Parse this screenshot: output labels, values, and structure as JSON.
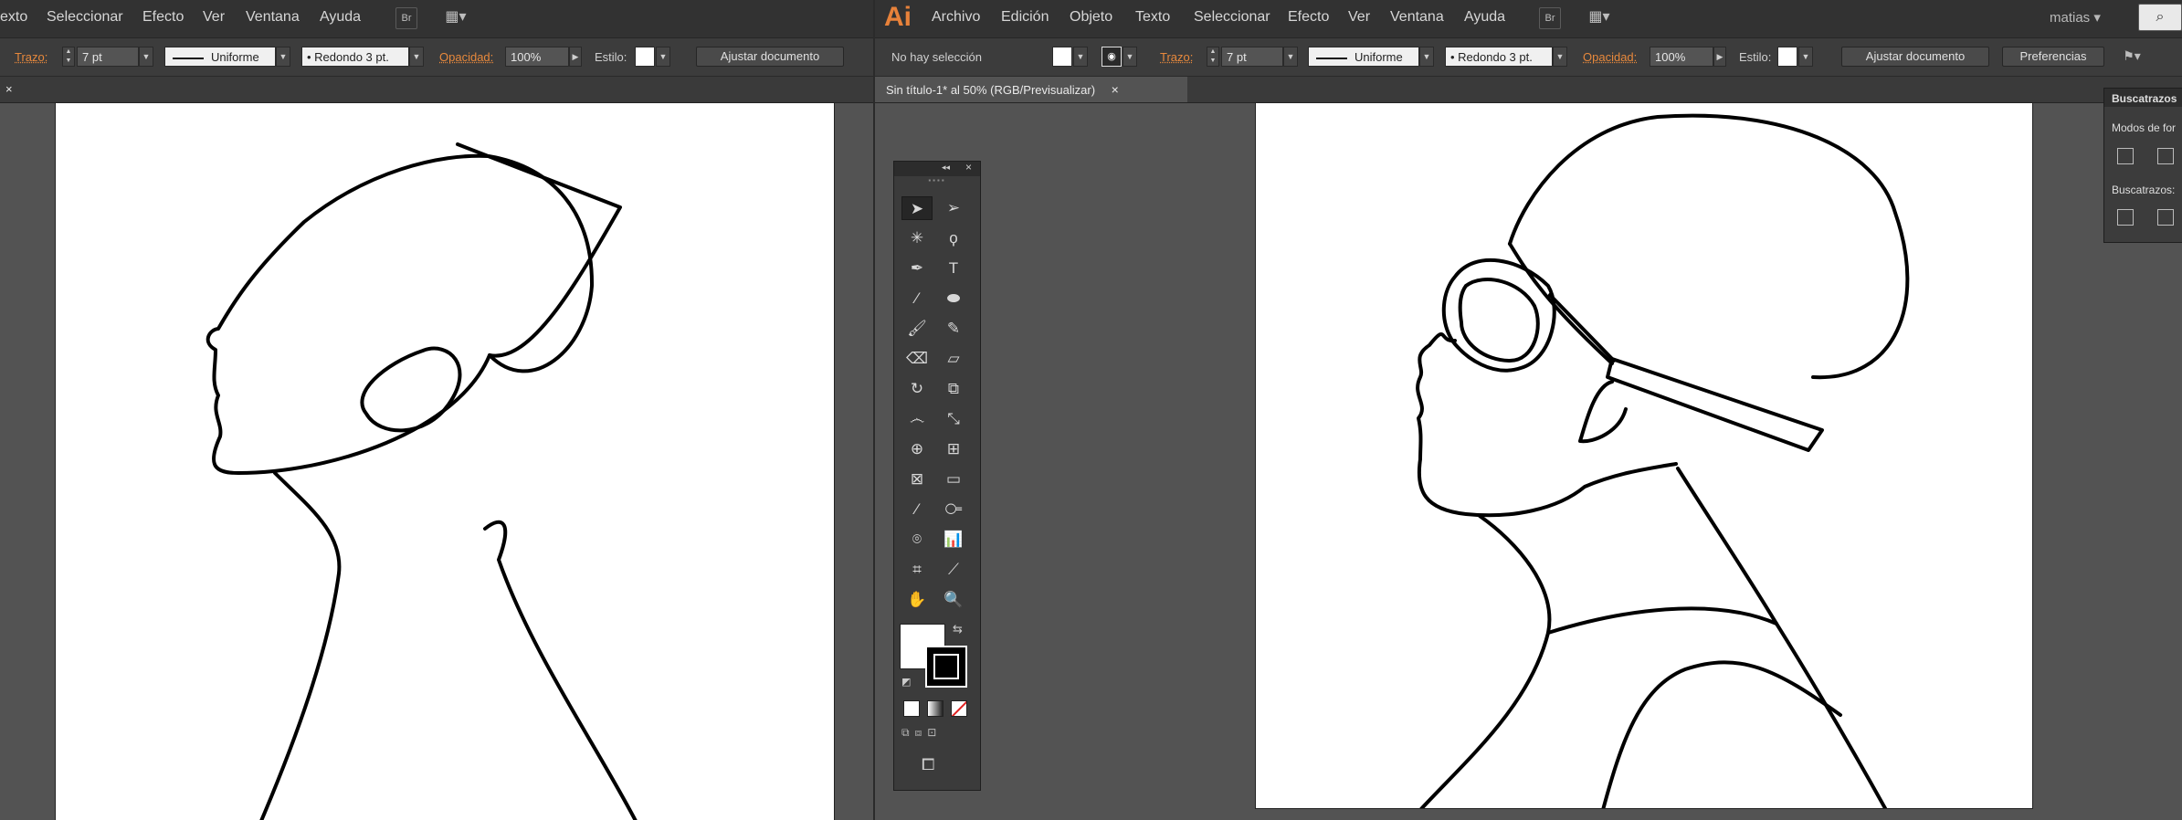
{
  "left_window": {
    "menu": [
      "exto",
      "Seleccionar",
      "Efecto",
      "Ver",
      "Ventana",
      "Ayuda"
    ],
    "bridge_icon": "Br",
    "control": {
      "stroke_label": "Trazo:",
      "stroke_value": "7 pt",
      "profile": "Uniforme",
      "brush": "Redondo 3 pt.",
      "opacity_label": "Opacidad:",
      "opacity_value": "100%",
      "style_label": "Estilo:",
      "fit_button": "Ajustar documento"
    },
    "tab_close": "×"
  },
  "right_window": {
    "app_logo": "Ai",
    "menu": [
      "Archivo",
      "Edición",
      "Objeto",
      "Texto",
      "Seleccionar",
      "Efecto",
      "Ver",
      "Ventana",
      "Ayuda"
    ],
    "bridge_icon": "Br",
    "user": "matias",
    "control": {
      "selection": "No hay selección",
      "stroke_label": "Trazo:",
      "stroke_value": "7 pt",
      "profile": "Uniforme",
      "brush": "Redondo 3 pt.",
      "opacity_label": "Opacidad:",
      "opacity_value": "100%",
      "style_label": "Estilo:",
      "fit_button": "Ajustar documento",
      "prefs_button": "Preferencias"
    },
    "document_tab": "Sin título-1* al 50% (RGB/Previsualizar)",
    "tab_close": "×",
    "pathfinder": {
      "title": "Buscatrazos",
      "modes_label": "Modos de for",
      "finders_label": "Buscatrazos:"
    }
  },
  "tools_panel": {
    "collapse": "◂◂",
    "close": "×",
    "tools": [
      {
        "name": "selection-tool",
        "glyph": "➤"
      },
      {
        "name": "direct-selection-tool",
        "glyph": "➢"
      },
      {
        "name": "magic-wand-tool",
        "glyph": "✳"
      },
      {
        "name": "lasso-tool",
        "glyph": "ϙ"
      },
      {
        "name": "pen-tool",
        "glyph": "✒"
      },
      {
        "name": "type-tool",
        "glyph": "T"
      },
      {
        "name": "line-tool",
        "glyph": "⁄"
      },
      {
        "name": "ellipse-tool",
        "glyph": "⬬"
      },
      {
        "name": "paintbrush-tool",
        "glyph": "🖌"
      },
      {
        "name": "pencil-tool",
        "glyph": "✎"
      },
      {
        "name": "blob-brush-tool",
        "glyph": "⌫"
      },
      {
        "name": "eraser-tool",
        "glyph": "▱"
      },
      {
        "name": "rotate-tool",
        "glyph": "↻"
      },
      {
        "name": "scale-tool",
        "glyph": "⧉"
      },
      {
        "name": "warp-tool",
        "glyph": "෴"
      },
      {
        "name": "free-transform-tool",
        "glyph": "⤡"
      },
      {
        "name": "shape-builder-tool",
        "glyph": "⊕"
      },
      {
        "name": "perspective-grid-tool",
        "glyph": "⊞"
      },
      {
        "name": "mesh-tool",
        "glyph": "⊠"
      },
      {
        "name": "gradient-tool",
        "glyph": "▭"
      },
      {
        "name": "eyedropper-tool",
        "glyph": "⁄"
      },
      {
        "name": "blend-tool",
        "glyph": "⧃"
      },
      {
        "name": "symbol-sprayer-tool",
        "glyph": "⌾"
      },
      {
        "name": "column-graph-tool",
        "glyph": "📊"
      },
      {
        "name": "artboard-tool",
        "glyph": "⌗"
      },
      {
        "name": "slice-tool",
        "glyph": "⟋"
      },
      {
        "name": "hand-tool",
        "glyph": "✋"
      },
      {
        "name": "zoom-tool",
        "glyph": "🔍"
      }
    ],
    "colors": {
      "fill": "#ffffff",
      "stroke": "#000000",
      "ui_accent": "#e8823a"
    }
  }
}
